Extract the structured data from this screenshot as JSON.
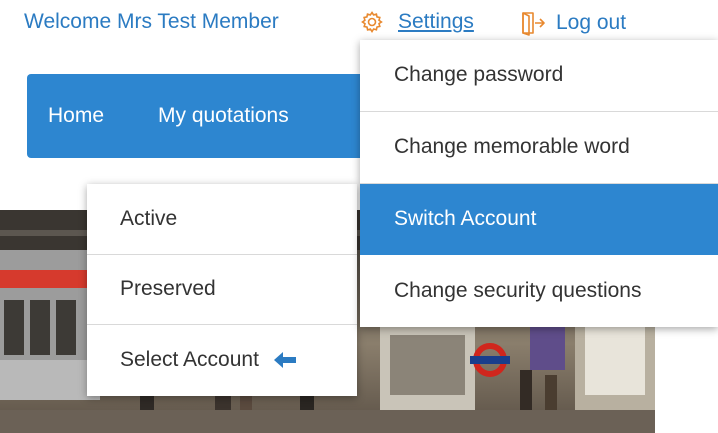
{
  "header": {
    "welcome_text": "Welcome Mrs Test Member",
    "settings_label": "Settings",
    "logout_label": "Log out",
    "settings_icon": "gear-icon",
    "logout_icon": "logout-door-icon"
  },
  "nav": {
    "items": [
      {
        "label": "Home"
      },
      {
        "label": "My quotations"
      }
    ]
  },
  "account_menu": {
    "items": [
      {
        "label": "Active"
      },
      {
        "label": "Preserved"
      },
      {
        "label": "Select Account",
        "icon": "arrow-left-icon"
      }
    ]
  },
  "settings_menu": {
    "items": [
      {
        "label": "Change password",
        "active": false
      },
      {
        "label": "Change memorable word",
        "active": false
      },
      {
        "label": "Switch Account",
        "active": true
      },
      {
        "label": "Change security questions",
        "active": false
      }
    ]
  },
  "colors": {
    "brand_blue": "#2d86d0",
    "link_blue": "#2b7bc2",
    "icon_orange": "#e8892f",
    "arrow_blue": "#2b7bc2"
  }
}
